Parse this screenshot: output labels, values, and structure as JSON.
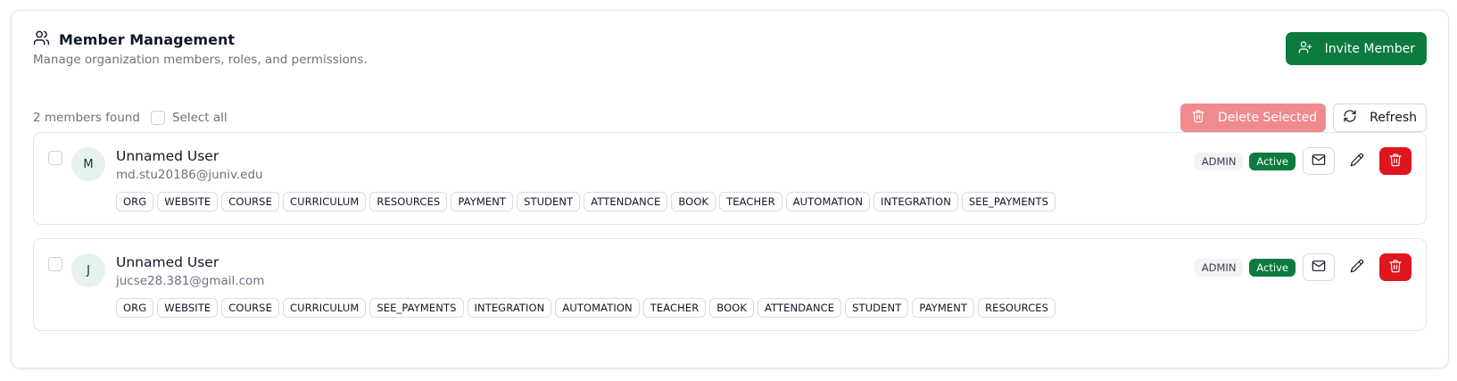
{
  "header": {
    "title": "Member Management",
    "subtitle": "Manage organization members, roles, and permissions.",
    "invite_label": "Invite Member"
  },
  "toolbar": {
    "count_text": "2 members found",
    "select_all_label": "Select all",
    "delete_selected_label": "Delete Selected",
    "refresh_label": "Refresh"
  },
  "members": [
    {
      "initial": "M",
      "name": "Unnamed User",
      "email": "md.stu20186@juniv.edu",
      "role": "ADMIN",
      "status": "Active",
      "permissions": [
        "ORG",
        "WEBSITE",
        "COURSE",
        "CURRICULUM",
        "RESOURCES",
        "PAYMENT",
        "STUDENT",
        "ATTENDANCE",
        "BOOK",
        "TEACHER",
        "AUTOMATION",
        "INTEGRATION",
        "SEE_PAYMENTS"
      ]
    },
    {
      "initial": "J",
      "name": "Unnamed User",
      "email": "jucse28.381@gmail.com",
      "role": "ADMIN",
      "status": "Active",
      "permissions": [
        "ORG",
        "WEBSITE",
        "COURSE",
        "CURRICULUM",
        "SEE_PAYMENTS",
        "INTEGRATION",
        "AUTOMATION",
        "TEACHER",
        "BOOK",
        "ATTENDANCE",
        "STUDENT",
        "PAYMENT",
        "RESOURCES"
      ]
    }
  ],
  "colors": {
    "primary": "#0d7a3f",
    "danger": "#e0161f",
    "danger_disabled": "#f08a8f"
  },
  "icons": {
    "title": "users-icon",
    "invite": "user-plus-icon",
    "delete_selected": "trash-icon",
    "refresh": "refresh-icon",
    "mail": "mail-icon",
    "edit": "pencil-icon",
    "delete": "trash-icon"
  }
}
